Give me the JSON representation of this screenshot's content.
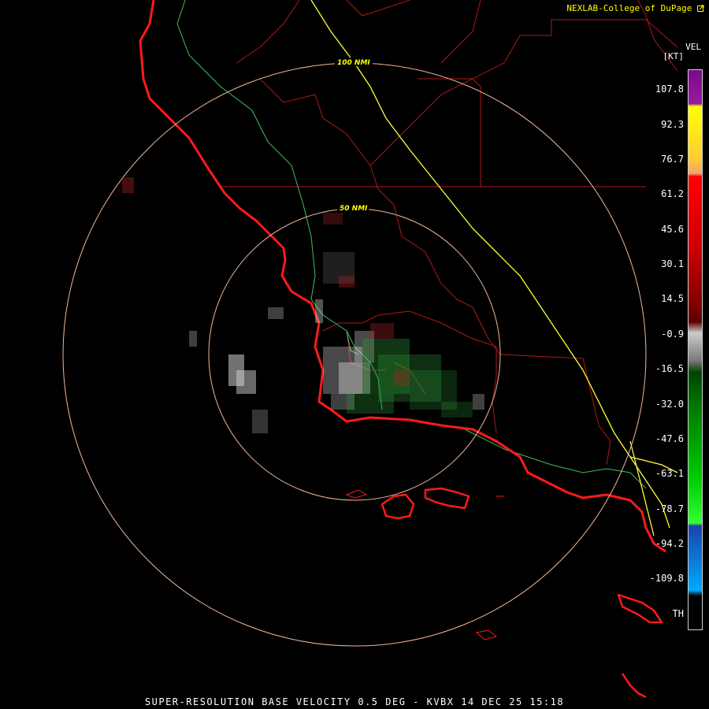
{
  "header": {
    "credit": "NEXLAB-College of DuPage"
  },
  "product": {
    "line": "SUPER-RESOLUTION BASE VELOCITY 0.5 DEG - KVBX 14 DEC 25 15:18"
  },
  "legend": {
    "title": "VEL",
    "units": "[KT]",
    "labels": [
      "107.8",
      "92.3",
      "76.7",
      "61.2",
      "45.6",
      "30.1",
      "14.5",
      "-0.9",
      "-16.5",
      "-32.0",
      "-47.6",
      "-63.1",
      "-78.7",
      "-94.2",
      "-109.8",
      "TH"
    ]
  },
  "rings": {
    "outer": "100 NMI",
    "inner": "50 NMI"
  },
  "colors": {
    "coastline": "#ff1a1a",
    "county_lines": "#b01818",
    "interstate": "#ffff33",
    "highway": "#3fbf5f",
    "range_rings": "#f0b898",
    "clutter": "#d0d0d0"
  }
}
